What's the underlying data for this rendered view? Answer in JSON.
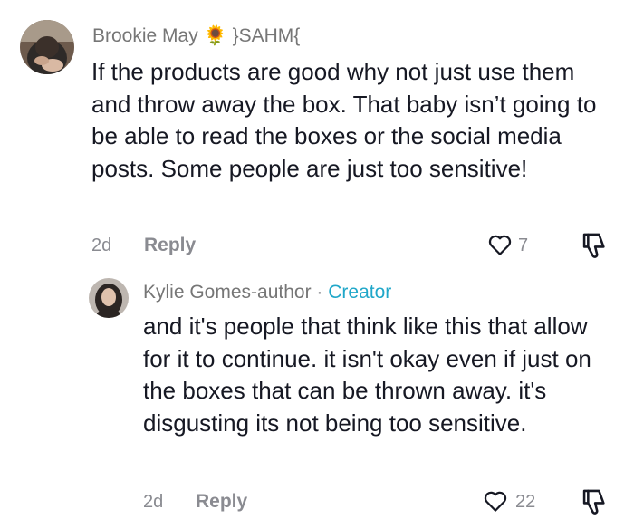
{
  "comments": [
    {
      "username": "Brookie May",
      "emoji": "🌻",
      "username_suffix": "}SAHM{",
      "text": "If the products are good why not just use them and throw away the box. That baby isn’t going to be able to read the boxes or the social media posts. Some people are just too sensitive!",
      "date": "2d",
      "reply_label": "Reply",
      "likes": "7"
    }
  ],
  "reply": {
    "username": "Kylie Gomes-author",
    "separator": "·",
    "badge": "Creator",
    "text": "and it's people that think like this that allow for it to continue. it isn't okay even if just on the boxes that can be thrown away. it's disgusting its not being too sensitive.",
    "date": "2d",
    "reply_label": "Reply",
    "likes": "22"
  },
  "colors": {
    "text": "#161823",
    "secondary": "#8a8b91",
    "creator": "#20a7c9"
  },
  "icons": [
    "heart-icon",
    "dislike-icon"
  ]
}
